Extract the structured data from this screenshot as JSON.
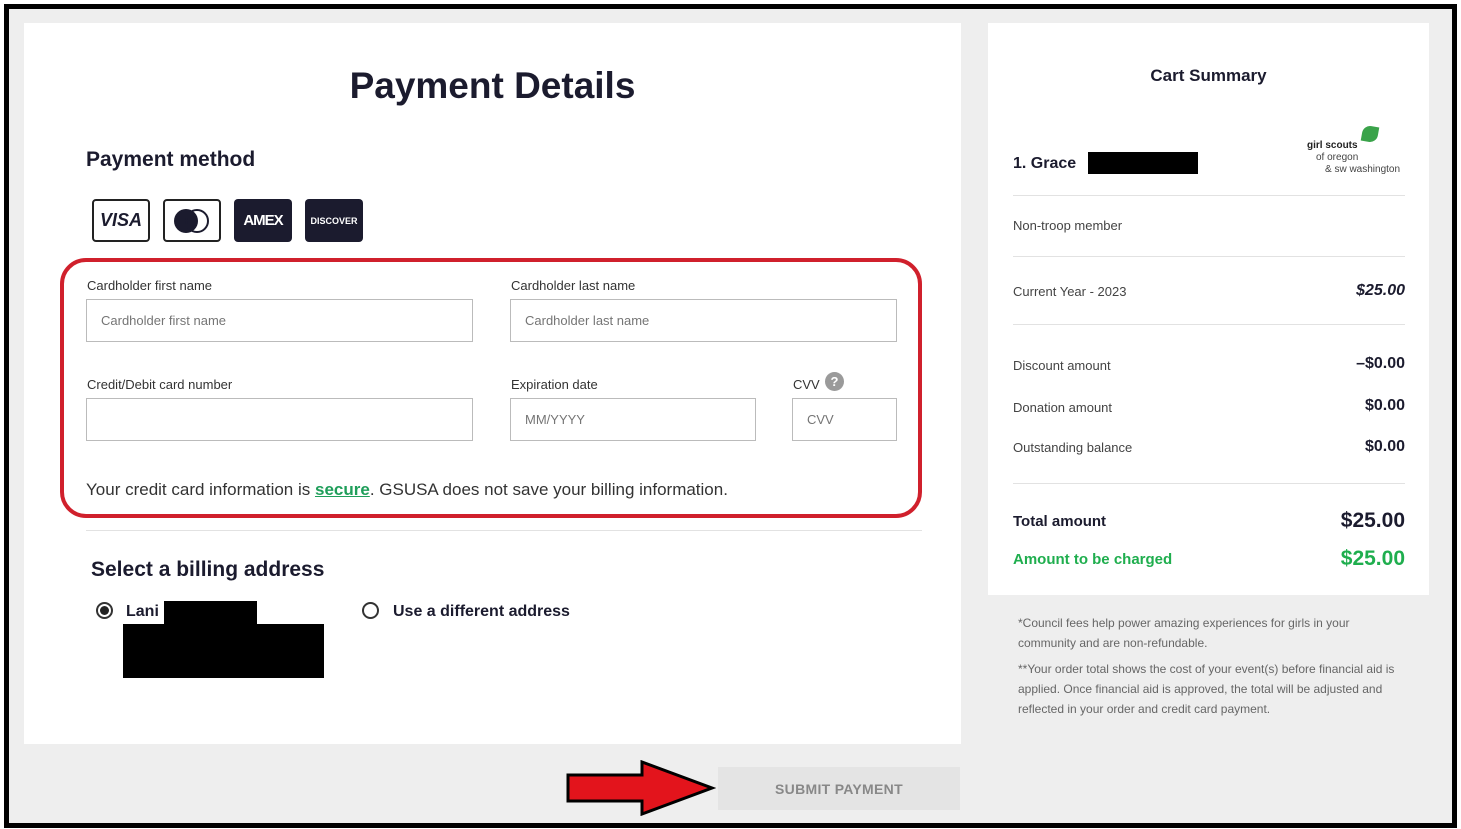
{
  "payment": {
    "title": "Payment Details",
    "method_title": "Payment method",
    "card_brands": [
      {
        "name": "VISA",
        "icon": "visa-icon"
      },
      {
        "name": "Mastercard",
        "icon": "mastercard-icon"
      },
      {
        "name": "AMEX",
        "icon": "amex-icon"
      },
      {
        "name": "DISCOVER",
        "icon": "discover-icon"
      }
    ],
    "first_name": {
      "label": "Cardholder first name",
      "placeholder": "Cardholder first name",
      "value": ""
    },
    "last_name": {
      "label": "Cardholder last name",
      "placeholder": "Cardholder last name",
      "value": ""
    },
    "card_number": {
      "label": "Credit/Debit card number",
      "placeholder": "",
      "value": ""
    },
    "expiration": {
      "label": "Expiration date",
      "placeholder": "MM/YYYY",
      "value": ""
    },
    "cvv": {
      "label": "CVV",
      "placeholder": "CVV",
      "value": "",
      "help_icon": "question-circle-icon"
    },
    "secure_note": {
      "prefix": "Your credit card information is ",
      "link": "secure",
      "suffix": ". GSUSA does not save your billing information."
    },
    "highlight_color": "#d0202c"
  },
  "billing": {
    "title": "Select a billing address",
    "options": [
      {
        "label": "Lani",
        "selected": true
      },
      {
        "label": "Use a different address",
        "selected": false
      }
    ]
  },
  "cart": {
    "title": "Cart Summary",
    "item_name": "1. Grace",
    "org_logo": {
      "line1": "girl scouts",
      "line2": "of oregon",
      "line3": "& sw washington",
      "icon": "trefoil-leaf-icon"
    },
    "member_type": "Non-troop member",
    "lines": [
      {
        "label": "Current Year - 2023",
        "value": "$25.00"
      },
      {
        "label": "Discount amount",
        "value": "–$0.00"
      },
      {
        "label": "Donation amount",
        "value": "$0.00"
      },
      {
        "label": "Outstanding balance",
        "value": "$0.00"
      }
    ],
    "total": {
      "label": "Total amount",
      "value": "$25.00"
    },
    "charged": {
      "label": "Amount to be charged",
      "value": "$25.00"
    }
  },
  "footnotes": [
    "*Council fees help power amazing experiences for girls in your community and are non-refundable.",
    "**Your order total shows the cost of your event(s) before financial aid is applied. Once financial aid is approved, the total will be adjusted and reflected in your order and credit card payment."
  ],
  "submit": {
    "label": "SUBMIT PAYMENT",
    "enabled": false
  },
  "colors": {
    "accent_green": "#1fae4e",
    "dark_navy": "#1b1b2e",
    "annotation_red": "#d0202c"
  }
}
